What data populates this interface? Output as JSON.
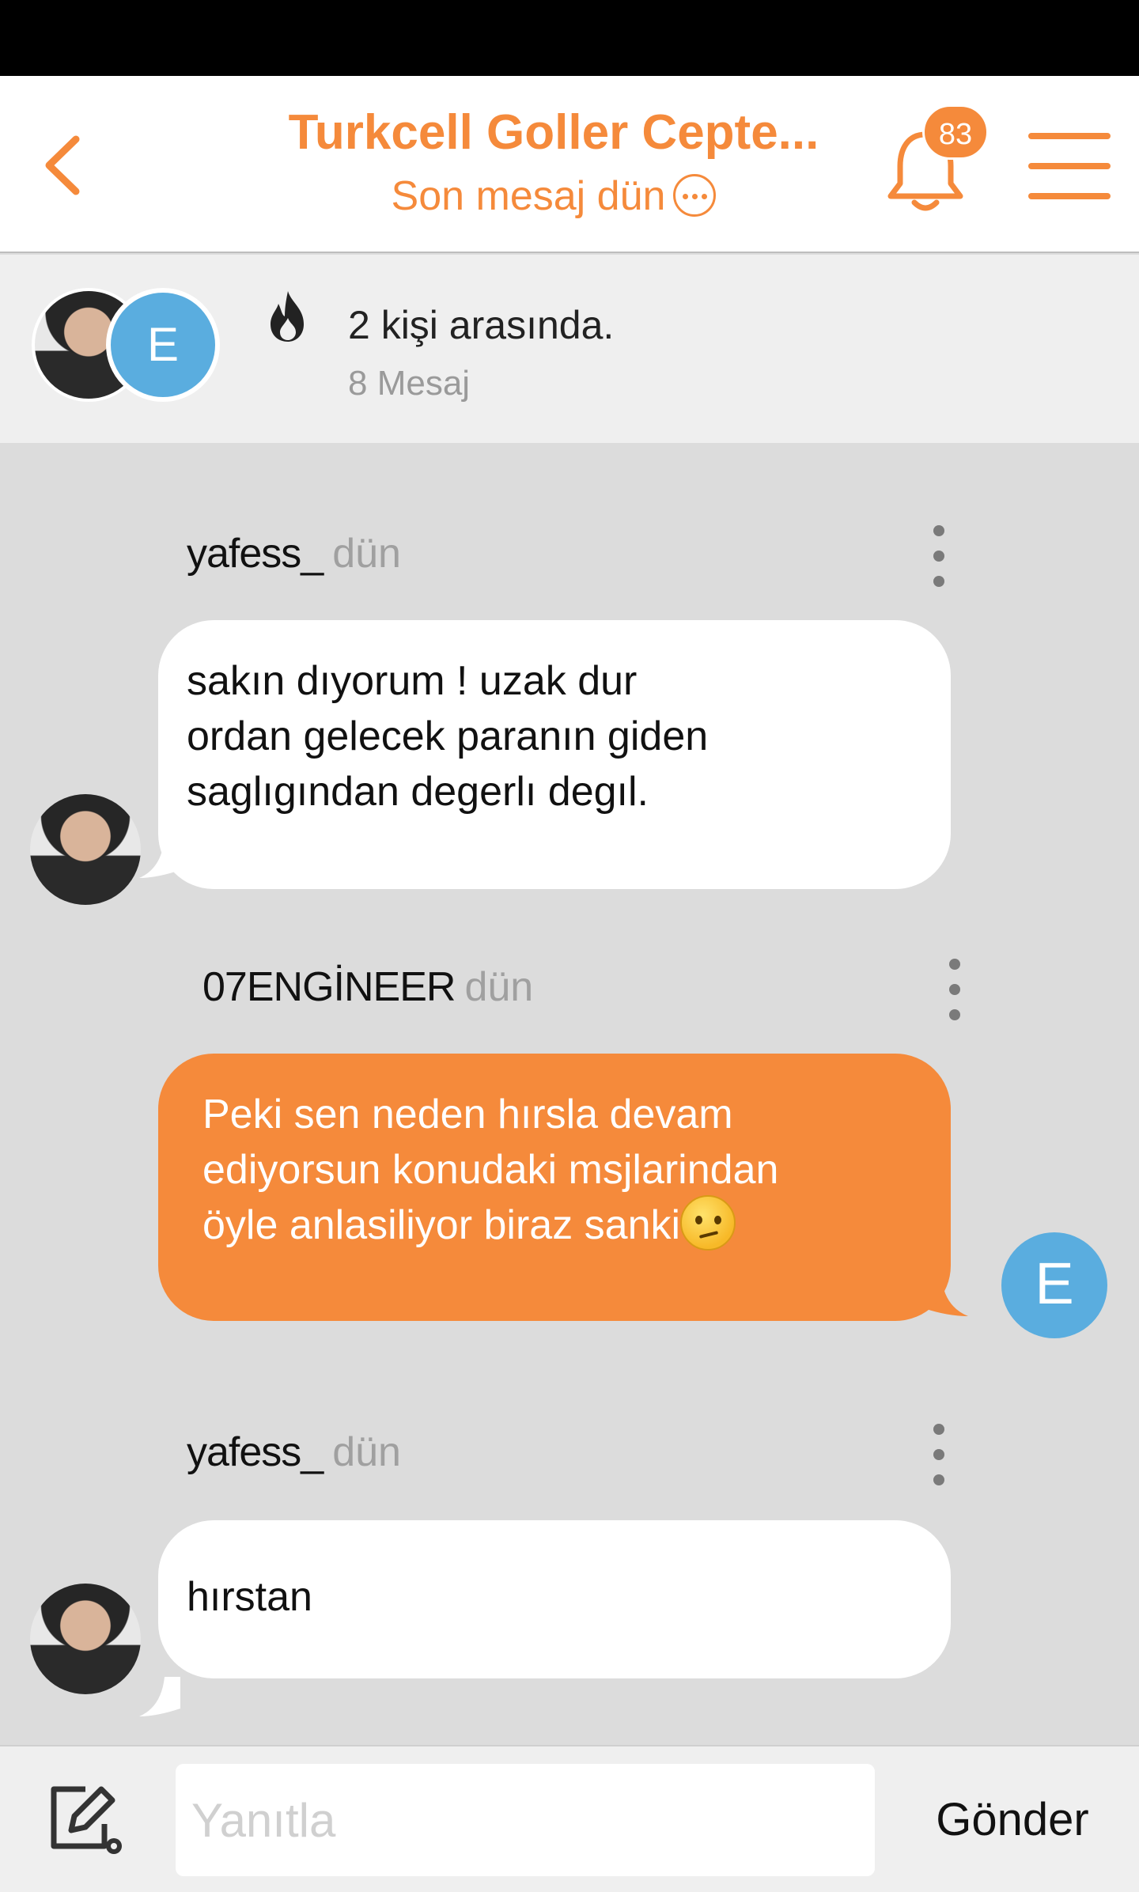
{
  "header": {
    "title": "Turkcell Goller Cepte...",
    "subtitle": "Son mesaj dün",
    "notification_count": "83",
    "icons": {
      "back": "back-chevron-icon",
      "more": "more-dots-icon",
      "bell": "bell-icon",
      "menu": "hamburger-menu-icon"
    },
    "accent_color": "#f58a3b"
  },
  "thread": {
    "participants_text": "2 kişi arasında.",
    "message_count": "8 Mesaj",
    "participant_avatar_letter": "E",
    "icon": "fire-icon"
  },
  "messages": [
    {
      "author": "yafess_",
      "time": "dün",
      "direction": "incoming",
      "lines": [
        "sakın dıyorum ! uzak dur",
        "ordan gelecek paranın giden",
        "saglıgından degerlı degıl."
      ]
    },
    {
      "author": "07ENGİNEER",
      "time": "dün",
      "direction": "outgoing",
      "avatar_letter": "E",
      "lines": [
        "Peki sen neden hırsla devam",
        "ediyorsun konudaki msjlarindan",
        "öyle anlasiliyor biraz sanki"
      ],
      "emoji": "confused-face-emoji"
    },
    {
      "author": "yafess_",
      "time": "dün",
      "direction": "incoming",
      "lines": [
        "hırstan"
      ]
    }
  ],
  "composer": {
    "placeholder": "Yanıtla",
    "send_label": "Gönder",
    "icon": "compose-settings-icon"
  }
}
